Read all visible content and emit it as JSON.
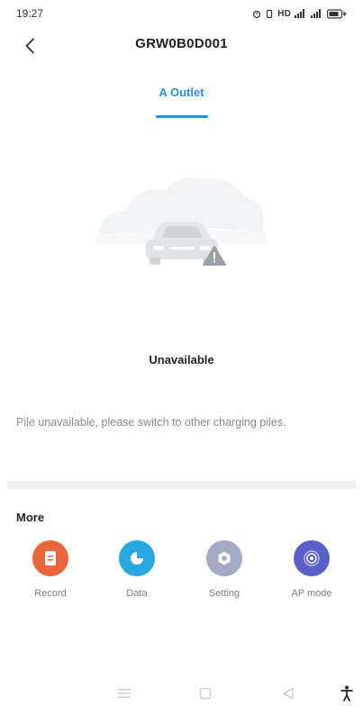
{
  "status_bar": {
    "time": "19:27",
    "icons_text": "HD",
    "icons": [
      "alarm-icon",
      "vibrate-icon",
      "hd-icon",
      "signal-icon",
      "signal-icon",
      "battery-icon"
    ]
  },
  "header": {
    "title": "GRW0B0D001",
    "back_icon": "chevron-left-icon"
  },
  "tabs": [
    {
      "label": "A Outlet",
      "active": true
    }
  ],
  "main": {
    "status_title": "Unavailable",
    "status_message": "Pile unavailable, please switch to other charging piles.",
    "illustration_icon": "car-warning-icon"
  },
  "more": {
    "title": "More",
    "items": [
      {
        "label": "Record",
        "icon": "record-icon",
        "color": "#e8663a"
      },
      {
        "label": "Data",
        "icon": "pie-chart-icon",
        "color": "#27a7e0"
      },
      {
        "label": "Setting",
        "icon": "gear-icon",
        "color": "#a3abc4"
      },
      {
        "label": "AP mode",
        "icon": "wireless-icon",
        "color": "#5b5fc7"
      }
    ]
  },
  "colors": {
    "accent": "#2a8fd8",
    "divider": "#eef1f4",
    "muted_text": "#8a8a8a"
  },
  "nav_bar": {
    "icons": [
      "menu-icon",
      "home-icon",
      "back-icon",
      "accessibility-icon"
    ]
  }
}
